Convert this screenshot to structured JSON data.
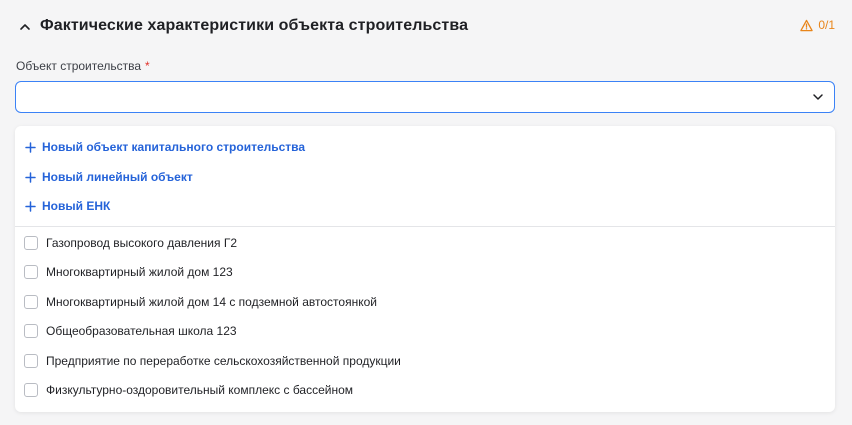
{
  "section": {
    "title": "Фактические характеристики объекта строительства",
    "progress": "0/1"
  },
  "field": {
    "label": "Объект строительства",
    "required_mark": "*",
    "value": ""
  },
  "dropdown": {
    "actions": [
      {
        "label": "Новый объект капитального строительства"
      },
      {
        "label": "Новый линейный объект"
      },
      {
        "label": "Новый ЕНК"
      }
    ],
    "options": [
      {
        "label": "Газопровод высокого давления Г2",
        "checked": false
      },
      {
        "label": "Многоквартирный жилой дом 123",
        "checked": false
      },
      {
        "label": "Многоквартирный жилой дом 14 с подземной автостоянкой",
        "checked": false
      },
      {
        "label": "Общеобразовательная школа 123",
        "checked": false
      },
      {
        "label": "Предприятие по переработке сельскохозяйственной продукции",
        "checked": false
      },
      {
        "label": "Физкультурно-оздоровительный комплекс с бассейном",
        "checked": false
      }
    ]
  },
  "colors": {
    "accent": "#2563d9",
    "focus_border": "#3b82f6",
    "warning": "#e8851a",
    "required": "#e0322b"
  },
  "icons": {
    "collapse": "chevron-up-icon",
    "warning": "warning-triangle-icon",
    "select": "chevron-down-icon",
    "add": "plus-icon",
    "checkbox": "checkbox-unchecked"
  }
}
